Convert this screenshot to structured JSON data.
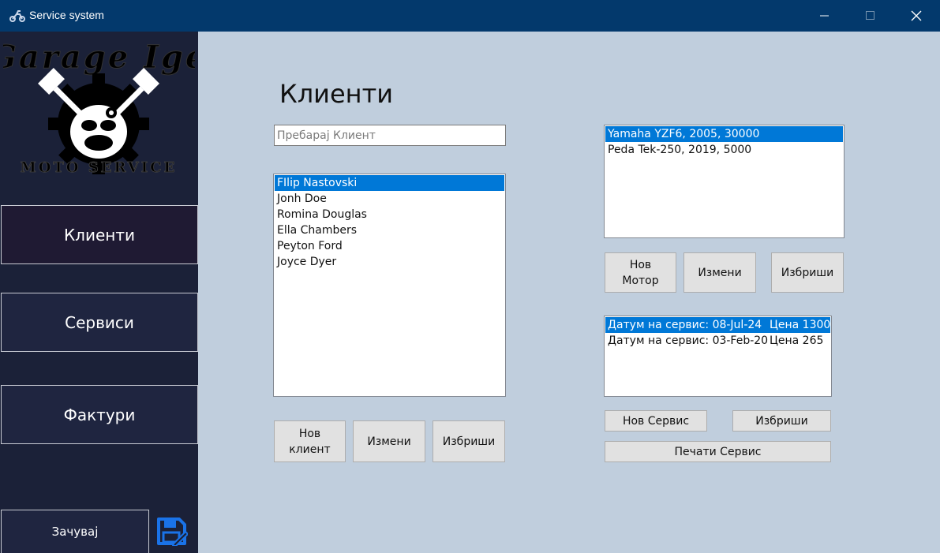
{
  "window": {
    "title": "Service system"
  },
  "logo": {
    "line1": "Garage Ige",
    "line2": "MOTO SERVICE"
  },
  "sidebar": {
    "nav": [
      {
        "label": "Клиенти",
        "active": true
      },
      {
        "label": "Сервиси",
        "active": false
      },
      {
        "label": "Фактури",
        "active": false
      }
    ],
    "save_label": "Зачувај"
  },
  "main": {
    "title": "Клиенти",
    "search": {
      "placeholder": "Пребарај Клиент",
      "value": ""
    },
    "clients": [
      "FIlip Nastovski",
      "Jonh Doe",
      "Romina Douglas",
      "Ella Chambers",
      "Peyton Ford",
      "Joyce Dyer"
    ],
    "selected_client_index": 0,
    "client_buttons": {
      "new_line1": "Нов",
      "new_line2": "клиент",
      "edit": "Измени",
      "delete": "Избриши"
    },
    "motorcycles": [
      "Yamaha YZF6, 2005, 30000",
      "Peda Tek-250, 2019, 5000"
    ],
    "selected_moto_index": 0,
    "moto_buttons": {
      "new_line1": "Нов",
      "new_line2": "Мотор",
      "edit": "Измени",
      "delete": "Избриши"
    },
    "services": [
      {
        "date": "Датум на сервис: 08-Jul-24",
        "price": "Цена  1300"
      },
      {
        "date": "Датум на сервис: 03-Feb-20",
        "price": "Цена  265"
      }
    ],
    "selected_service_index": 0,
    "service_buttons": {
      "new": "Нов Сервис",
      "delete": "Избриши",
      "print": "Печати Сервис"
    }
  },
  "colors": {
    "sidebar": "#1b2138",
    "titlebar": "#03396c",
    "background": "#c0cedd",
    "selection": "#0078d7",
    "save_icon": "#1a73e8"
  }
}
